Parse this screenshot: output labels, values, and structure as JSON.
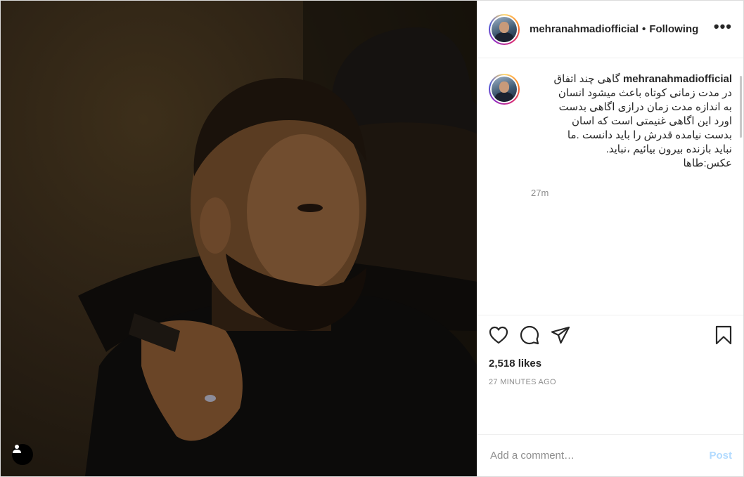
{
  "post": {
    "author": "mehranahmadiofficial",
    "separator": "•",
    "follow_status": "Following",
    "more_label": "•••",
    "caption": "گاهی چند اتفاق\nدر مدت زمانی کوتاه باعث میشود انسان\nبه اندازه مدت زمان درازی اگاهی بدست\nاورد این اگاهی غنیمتی است که اسان\nبدست نیامده قدرش را باید دانست .ما\nنباید بازنده بیرون بیائیم ،نباید.\nعکس:طاها",
    "caption_age": "27m",
    "likes": "2,518 likes",
    "posted_ago": "27 MINUTES AGO",
    "comment_placeholder": "Add a comment…",
    "post_button": "Post"
  },
  "icons": {
    "tag": "user-tag-icon",
    "more": "more-options-icon",
    "like": "heart-icon",
    "comment": "comment-bubble-icon",
    "share": "paper-plane-icon",
    "save": "bookmark-icon"
  },
  "colors": {
    "text": "#262626",
    "muted": "#8e8e8e",
    "border": "#dbdbdb",
    "post_button_disabled": "#b3dbff"
  }
}
